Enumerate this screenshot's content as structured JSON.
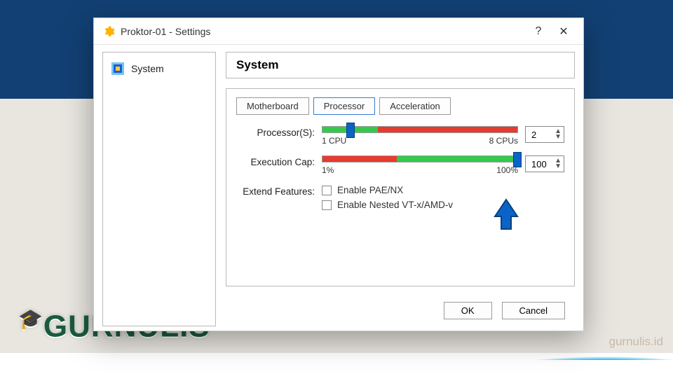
{
  "titlebar": {
    "title": "Proktor-01 - Settings"
  },
  "sidebar": {
    "items": [
      {
        "label": "System"
      }
    ]
  },
  "header": {
    "title": "System"
  },
  "tabs": [
    "Motherboard",
    "Processor",
    "Acceleration"
  ],
  "active_tab_index": 1,
  "processor": {
    "label": "Processor(S):",
    "min_label": "1 CPU",
    "max_label": "8 CPUs",
    "min": 1,
    "max": 8,
    "value": 2,
    "green_from": 1,
    "green_to": 3,
    "spin_value": "2"
  },
  "exec_cap": {
    "label": "Execution Cap:",
    "min_label": "1%",
    "max_label": "100%",
    "min": 1,
    "max": 100,
    "value": 100,
    "red_to": 38,
    "spin_value": "100"
  },
  "features": {
    "label": "Extend Features:",
    "opts": [
      "Enable PAE/NX",
      "Enable Nested VT-x/AMD-v"
    ]
  },
  "buttons": {
    "ok": "OK",
    "cancel": "Cancel"
  },
  "watermark": {
    "url": "gurnulis.id",
    "logo": "GURNULIS"
  }
}
